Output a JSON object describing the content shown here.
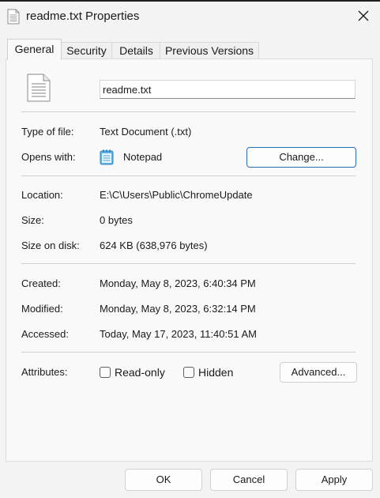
{
  "window": {
    "title": "readme.txt Properties",
    "close_icon": "close-icon",
    "title_icon": "text-file-icon"
  },
  "tabs": [
    {
      "label": "General",
      "active": true
    },
    {
      "label": "Security",
      "active": false
    },
    {
      "label": "Details",
      "active": false
    },
    {
      "label": "Previous Versions",
      "active": false
    }
  ],
  "general": {
    "file_name": "readme.txt",
    "file_icon": "text-document-icon",
    "type_of_file": {
      "label": "Type of file:",
      "value": "Text Document (.txt)"
    },
    "opens_with": {
      "label": "Opens with:",
      "app": "Notepad",
      "app_icon": "notepad-icon",
      "change_label": "Change..."
    },
    "location": {
      "label": "Location:",
      "value": "E:\\C\\Users\\Public\\ChromeUpdate"
    },
    "size": {
      "label": "Size:",
      "value": "0 bytes"
    },
    "size_on_disk": {
      "label": "Size on disk:",
      "value": "624 KB (638,976 bytes)"
    },
    "created": {
      "label": "Created:",
      "value": "Monday, May 8, 2023, 6:40:34 PM"
    },
    "modified": {
      "label": "Modified:",
      "value": "Monday, May 8, 2023, 6:32:14 PM"
    },
    "accessed": {
      "label": "Accessed:",
      "value": "Today, May 17, 2023, 11:40:51 AM"
    },
    "attributes": {
      "label": "Attributes:",
      "read_only": {
        "label": "Read-only",
        "checked": false
      },
      "hidden": {
        "label": "Hidden",
        "checked": false
      },
      "advanced_label": "Advanced..."
    }
  },
  "footer": {
    "ok_label": "OK",
    "cancel_label": "Cancel",
    "apply_label": "Apply"
  },
  "colors": {
    "window_bg": "#f3f3f3",
    "panel_bg": "#f9f9f9",
    "accent_border": "#2b6cb8"
  }
}
